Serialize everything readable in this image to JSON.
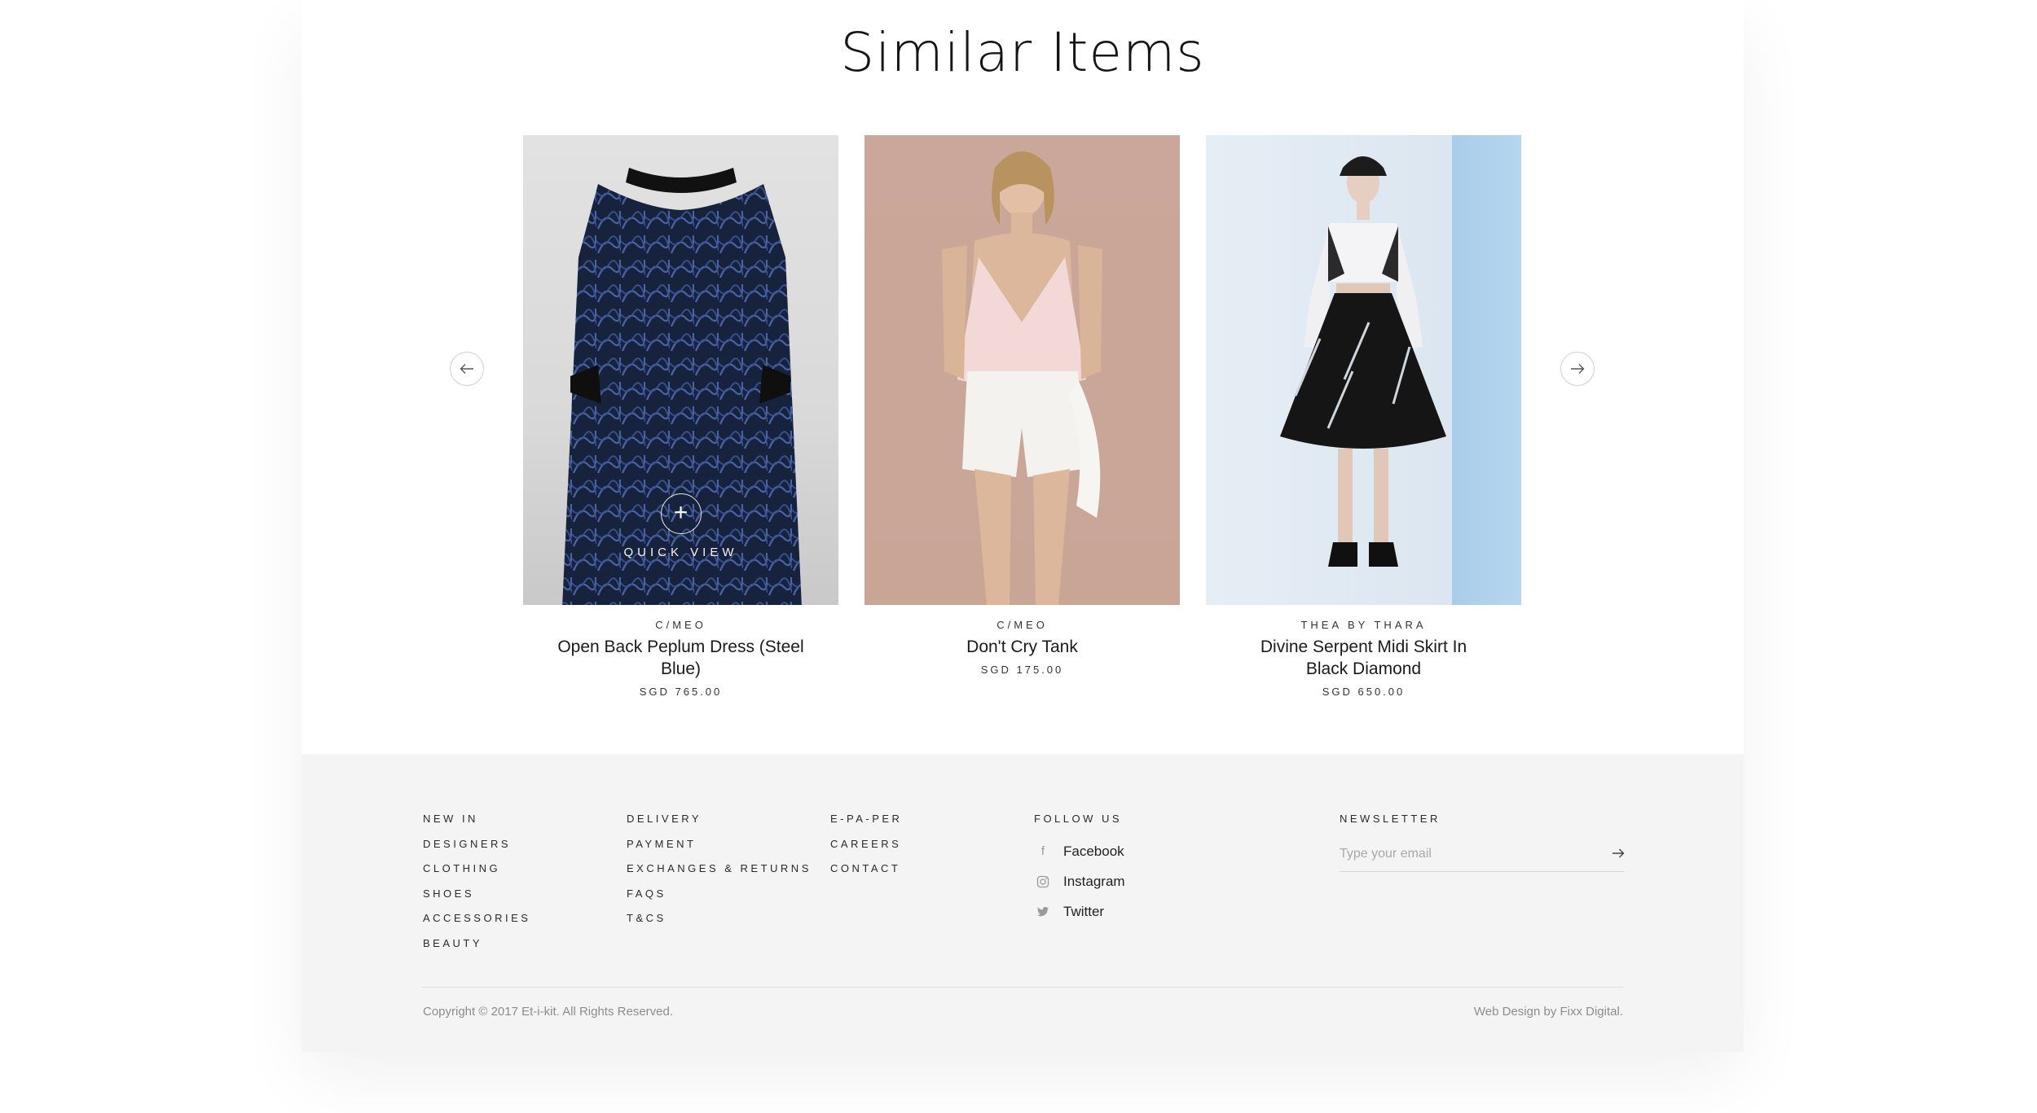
{
  "section": {
    "title": "Similar Items"
  },
  "products": [
    {
      "brand": "C/MEO",
      "name": "Open Back Peplum Dress (Steel Blue)",
      "price": "SGD 765.00",
      "image": "dress-photo"
    },
    {
      "brand": "C/MEO",
      "name": "Don't Cry Tank",
      "price": "SGD 175.00",
      "image": "tank-photo"
    },
    {
      "brand": "THEA BY THARA",
      "name": "Divine Serpent Midi Skirt In Black Diamond",
      "price": "SGD 650.00",
      "image": "skirt-photo"
    }
  ],
  "quick_view": {
    "label": "QUICK VIEW",
    "icon": "plus-icon"
  },
  "carousel": {
    "prev_icon": "arrow-left-icon",
    "next_icon": "arrow-right-icon"
  },
  "footer": {
    "col1": [
      "NEW IN",
      "DESIGNERS",
      "CLOTHING",
      "SHOES",
      "ACCESSORIES",
      "BEAUTY"
    ],
    "col2": [
      "DELIVERY",
      "PAYMENT",
      "EXCHANGES & RETURNS",
      "FAQS",
      "T&CS"
    ],
    "col3": [
      "E-PA-PER",
      "CAREERS",
      "CONTACT"
    ],
    "follow": {
      "title": "FOLLOW US",
      "items": [
        {
          "label": "Facebook",
          "icon": "facebook-icon"
        },
        {
          "label": "Instagram",
          "icon": "instagram-icon"
        },
        {
          "label": "Twitter",
          "icon": "twitter-icon"
        }
      ]
    },
    "newsletter": {
      "title": "NEWSLETTER",
      "placeholder": "Type your email",
      "value": ""
    },
    "copyright": "Copyright © 2017 Et-i-kit. All Rights Reserved.",
    "credit": "Web Design by Fixx Digital."
  },
  "colors": {
    "footer_bg": "#f4f4f4",
    "text": "#1a1a1a",
    "muted": "#8c8c8c"
  }
}
